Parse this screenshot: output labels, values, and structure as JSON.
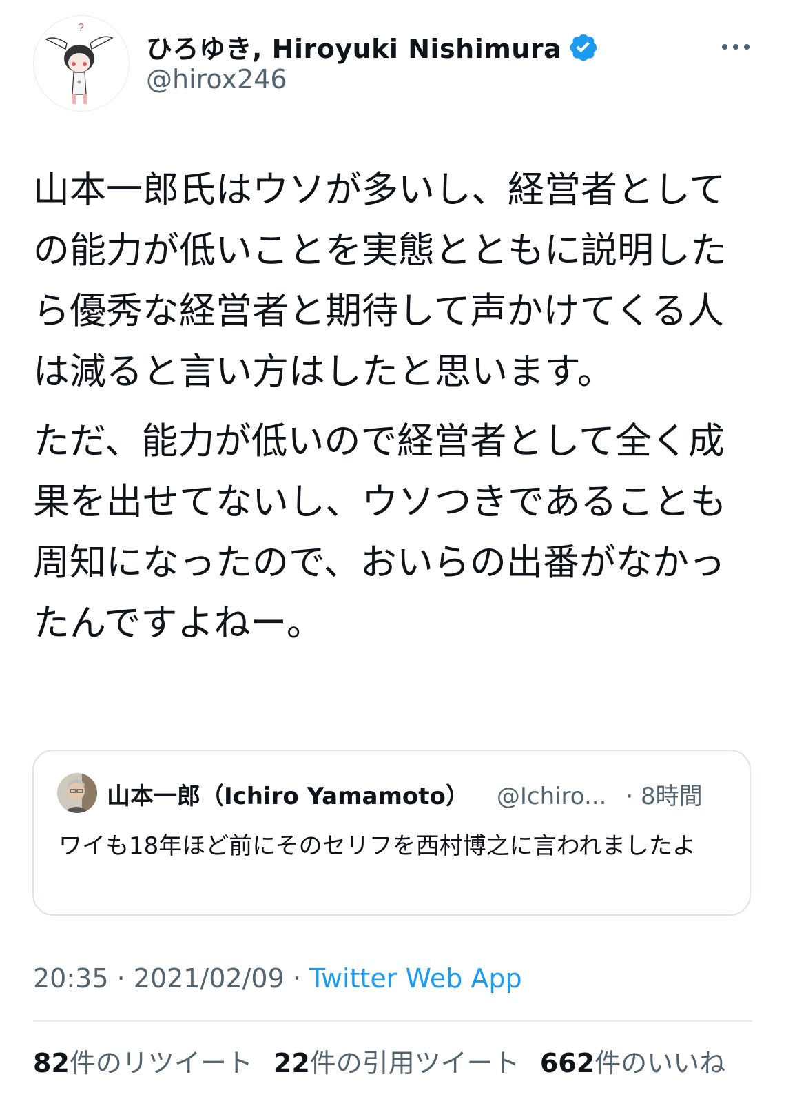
{
  "author": {
    "display_name": "ひろゆき, Hiroyuki Nishimura",
    "handle": "@hirox246"
  },
  "tweet": {
    "paragraphs": [
      "山本一郎氏はウソが多いし、経営者としての能力が低いことを実態とともに説明したら優秀な経営者と期待して声かけてくる人は減ると言い方はしたと思います。",
      "ただ、能力が低いので経営者として全く成果を出せてないし、ウソつきであることも周知になったので、おいらの出番がなかったんですよねー。"
    ]
  },
  "quote": {
    "name": "山本一郎（Ichiro Yamamoto）",
    "handle": "@Ichiro...",
    "time": "· 8時間",
    "text": "ワイも18年ほど前にそのセリフを西村博之に言われましたよ"
  },
  "meta": {
    "time": "20:35",
    "sep1": " · ",
    "date": "2021/02/09",
    "sep2": " · ",
    "app": "Twitter Web App"
  },
  "stats": {
    "retweets": "82",
    "retweets_label": "件のリツイート",
    "quotes": "22",
    "quotes_label": "件の引用ツイート",
    "likes": "662",
    "likes_label": "件のいいね"
  },
  "icons": {
    "verified": "verified-badge-icon",
    "more": "more-options-icon"
  },
  "colors": {
    "link": "#1d9bf0",
    "secondary": "#536471",
    "text": "#0f1419"
  }
}
